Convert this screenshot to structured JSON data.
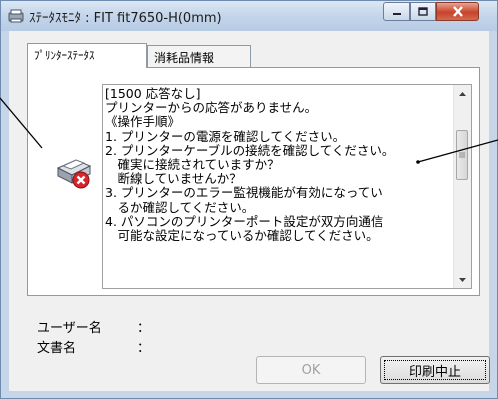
{
  "window": {
    "title": "ｽﾃｰﾀｽﾓﾆﾀ : FIT fit7650-H(0mm)",
    "controls": {
      "minimize": "minimize-icon",
      "maximize": "maximize-icon",
      "close": "close-icon"
    }
  },
  "tabs": [
    {
      "label": "ﾌﾟﾘﾝﾀｰｽﾃｰﾀｽ",
      "active": true
    },
    {
      "label": "消耗品情報",
      "active": false
    }
  ],
  "status": {
    "icon": "printer-error-icon",
    "message_lines": [
      "[1500 応答なし]",
      "プリンターからの応答がありません。",
      "《操作手順》",
      "1. プリンターの電源を確認してください。",
      "2. プリンターケーブルの接続を確認してください。",
      "　確実に接続されていますか？",
      "　断線していませんか？",
      "3. プリンターのエラー監視機能が有効になってい",
      "　るか確認してください。",
      "4. パソコンのプリンターポート設定が双方向通信",
      "　可能な設定になっているか確認してください。"
    ]
  },
  "fields": {
    "user_label": "ユーザー名",
    "user_colon": "：",
    "user_value": "",
    "doc_label": "文書名",
    "doc_colon": "：",
    "doc_value": ""
  },
  "buttons": {
    "ok_label": "OK",
    "ok_enabled": false,
    "cancel_print_label": "印刷中止"
  },
  "colors": {
    "title_bar": "#c3d5ea",
    "close_button": "#c7432a",
    "error_badge": "#d8252c"
  }
}
